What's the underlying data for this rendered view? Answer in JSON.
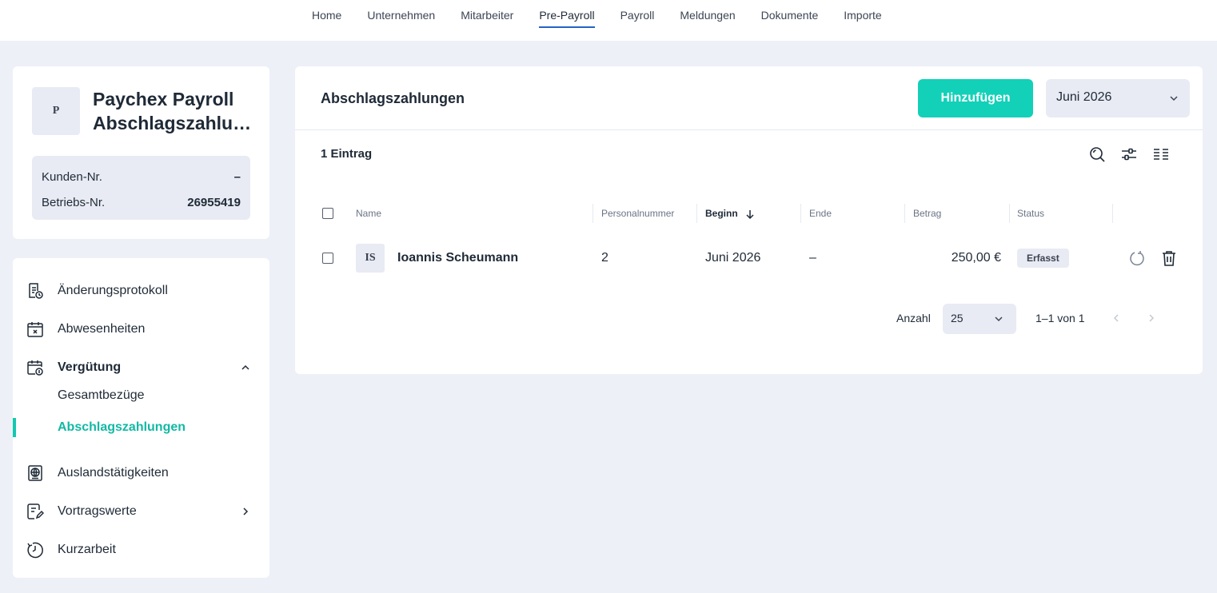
{
  "topnav": {
    "tabs": [
      "Home",
      "Unternehmen",
      "Mitarbeiter",
      "Pre-Payroll",
      "Payroll",
      "Meldungen",
      "Dokumente",
      "Importe"
    ],
    "active": "Pre-Payroll"
  },
  "company": {
    "logo_letter": "P",
    "name_line1": "Paychex Payroll",
    "name_line2": "Abschlagszahlu…",
    "kunden_label": "Kunden-Nr.",
    "kunden_value": "–",
    "betriebs_label": "Betriebs-Nr.",
    "betriebs_value": "26955419"
  },
  "sidebar": {
    "items": [
      {
        "label": "Änderungsprotokoll",
        "icon": "document-clock-icon"
      },
      {
        "label": "Abwesenheiten",
        "icon": "calendar-x-icon"
      },
      {
        "label": "Vergütung",
        "icon": "calendar-money-icon",
        "expanded": true
      },
      {
        "label": "Auslandstätigkeiten",
        "icon": "globe-document-icon"
      },
      {
        "label": "Vortragswerte",
        "icon": "edit-document-icon"
      },
      {
        "label": "Kurzarbeit",
        "icon": "clock-icon"
      }
    ],
    "subitems": [
      {
        "label": "Gesamtbezüge",
        "active": false
      },
      {
        "label": "Abschlagszahlungen",
        "active": true
      }
    ]
  },
  "main": {
    "title": "Abschlagszahlungen",
    "add_label": "Hinzufügen",
    "month": "Juni 2026",
    "entry_count": "1 Eintrag"
  },
  "table": {
    "headers": {
      "name": "Name",
      "personalnummer": "Personalnummer",
      "beginn": "Beginn",
      "ende": "Ende",
      "betrag": "Betrag",
      "status": "Status"
    },
    "sort_column": "Beginn",
    "sort_direction": "descending",
    "rows": [
      {
        "initials": "IS",
        "name": "Ioannis Scheumann",
        "personalnummer": "2",
        "beginn": "Juni 2026",
        "ende": "–",
        "betrag": "250,00 €",
        "status": "Erfasst"
      }
    ]
  },
  "pagination": {
    "label": "Anzahl",
    "page_size": "25",
    "range": "1–1 von 1"
  },
  "colors": {
    "accent": "#12d1b8",
    "active_text": "#12b9a4",
    "nav_underline": "#2563c4",
    "background": "#edf0f7",
    "chip": "#e8ebf3"
  }
}
